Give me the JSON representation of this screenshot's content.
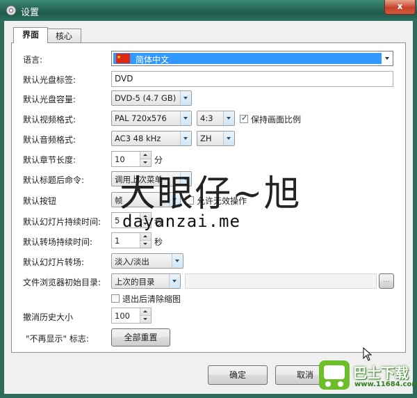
{
  "window": {
    "title": "设置",
    "close_glyph": "x",
    "accent": "#2e6b5b"
  },
  "tabs": [
    {
      "label": "界面"
    },
    {
      "label": "核心"
    }
  ],
  "settings": {
    "language": {
      "label": "语言:",
      "value": "简体中文"
    },
    "disc_label": {
      "label": "默认光盘标签:",
      "value": "DVD"
    },
    "disc_capacity": {
      "label": "默认光盘容量:",
      "value": "DVD-5 (4.7 GB)"
    },
    "video_format": {
      "label": "默认视频格式:",
      "value": "PAL 720x576",
      "aspect": "4:3",
      "keep_ratio_label": "保持画面比例",
      "keep_ratio_checked": true
    },
    "audio_format": {
      "label": "默认音频格式:",
      "value": "AC3 48 kHz",
      "lang": "ZH"
    },
    "chapter_length": {
      "label": "默认章节长度:",
      "value": "10",
      "unit": "分"
    },
    "title_command": {
      "label": "默认标题后命令:",
      "value": "调用上次菜单"
    },
    "button": {
      "label": "默认按钮",
      "value": "帧",
      "allow_label": "允许无效操作",
      "allow_checked": false
    },
    "slide_duration": {
      "label": "默认幻灯片持续时间:",
      "value": "5",
      "unit": "秒"
    },
    "transition_duration": {
      "label": "默认转场持续时间:",
      "value": "1",
      "unit": "秒"
    },
    "slide_transition": {
      "label": "默认幻灯片转场:",
      "value": "淡入/淡出"
    },
    "browser_dir": {
      "label": "文件浏览器初始目录:",
      "value": "上次的目录",
      "path": "",
      "browse": "..."
    },
    "clear_thumbs": {
      "label": "退出后清除缩图",
      "checked": false
    },
    "undo_history": {
      "label": "撤消历史大小",
      "value": "100"
    },
    "no_show": {
      "label": "\"不再显示\" 标志:",
      "reset_button": "全部重置"
    }
  },
  "footer": {
    "ok": "确定",
    "cancel": "取消"
  },
  "watermark": {
    "text": "大眼仔~旭",
    "url": "dayanzai.me",
    "site_name": "巴士下载",
    "site_url": "www.11684.com"
  }
}
